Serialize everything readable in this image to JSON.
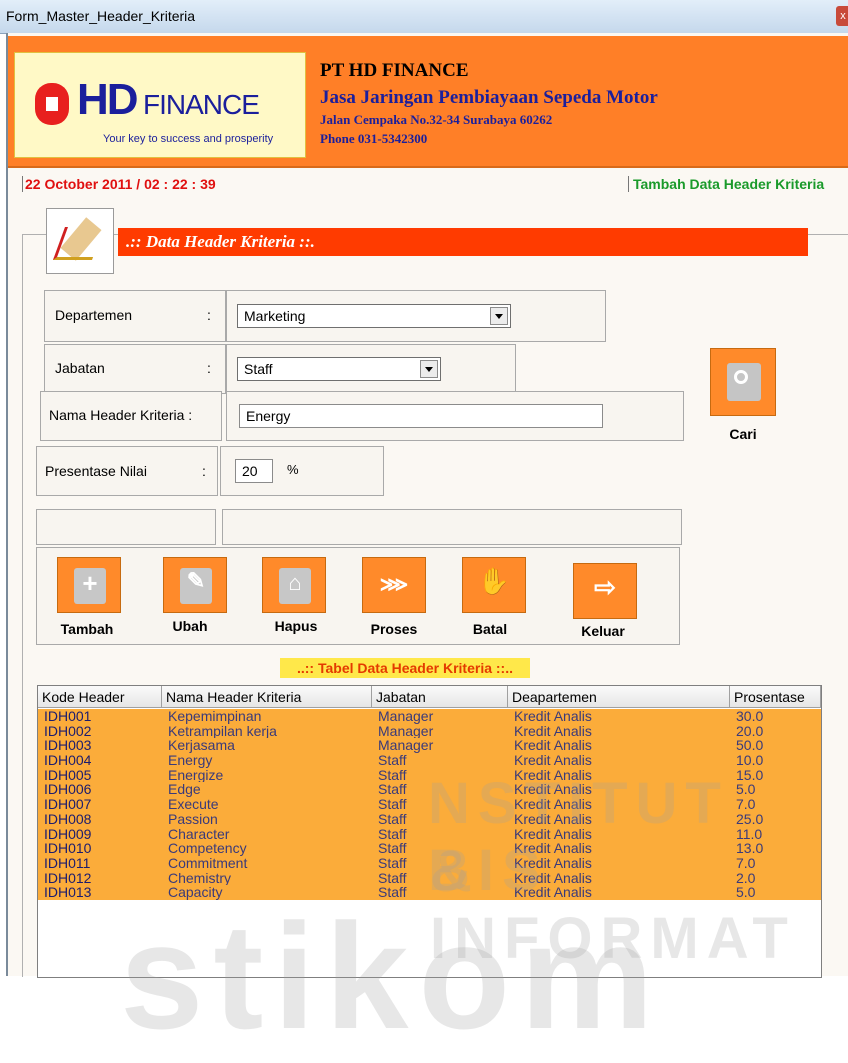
{
  "window": {
    "title": "Form_Master_Header_Kriteria",
    "close_glyph": "x"
  },
  "company": {
    "logo_brand": "HD",
    "logo_word": "FINANCE",
    "logo_tagline": "Your key to success and prosperity",
    "name": "PT HD FINANCE",
    "tagline": "Jasa Jaringan Pembiayaan Sepeda Motor",
    "address": "Jalan Cempaka No.32-34 Surabaya 60262",
    "phone": "Phone 031-5342300"
  },
  "status": {
    "datetime": "22 October 2011 / 02 : 22 : 39",
    "mode": "Tambah Data Header Kriteria"
  },
  "panel": {
    "title": ".:: Data Header Kriteria ::."
  },
  "form": {
    "departemen": {
      "label": "Departemen",
      "colon": ":",
      "value": "Marketing"
    },
    "jabatan": {
      "label": "Jabatan",
      "colon": ":",
      "value": "Staff"
    },
    "nama": {
      "label": "Nama Header Kriteria :",
      "value": "Energy"
    },
    "presentase": {
      "label": "Presentase Nilai",
      "colon": ":",
      "value": "20",
      "unit": "%"
    },
    "cari_label": "Cari"
  },
  "buttons": [
    {
      "label": "Tambah",
      "icon": "plus-icon"
    },
    {
      "label": "Ubah",
      "icon": "pencil-icon"
    },
    {
      "label": "Hapus",
      "icon": "basket-icon"
    },
    {
      "label": "Proses",
      "icon": "process-icon"
    },
    {
      "label": "Batal",
      "icon": "hand-icon"
    },
    {
      "label": "Keluar",
      "icon": "exit-icon"
    }
  ],
  "table": {
    "caption": "..:: Tabel Data Header Kriteria ::..",
    "headers": [
      "Kode Header",
      "Nama Header Kriteria",
      "Jabatan",
      "Deapartemen",
      "Prosentase"
    ],
    "rows": [
      [
        "IDH001",
        "Kepemimpinan",
        "Manager",
        "Kredit Analis",
        "30.0"
      ],
      [
        "IDH002",
        "Ketrampilan kerja",
        "Manager",
        "Kredit Analis",
        "20.0"
      ],
      [
        "IDH003",
        "Kerjasama",
        "Manager",
        "Kredit Analis",
        "50.0"
      ],
      [
        "IDH004",
        "Energy",
        "Staff",
        "Kredit Analis",
        "10.0"
      ],
      [
        "IDH005",
        "Energize",
        "Staff",
        "Kredit Analis",
        "15.0"
      ],
      [
        "IDH006",
        "Edge",
        "Staff",
        "Kredit Analis",
        "5.0"
      ],
      [
        "IDH007",
        "Execute",
        "Staff",
        "Kredit Analis",
        "7.0"
      ],
      [
        "IDH008",
        "Passion",
        "Staff",
        "Kredit Analis",
        "25.0"
      ],
      [
        "IDH009",
        "Character",
        "Staff",
        "Kredit Analis",
        "11.0"
      ],
      [
        "IDH010",
        "Competency",
        "Staff",
        "Kredit Analis",
        "13.0"
      ],
      [
        "IDH011",
        "Commitment",
        "Staff",
        "Kredit Analis",
        "7.0"
      ],
      [
        "IDH012",
        "Chemistry",
        "Staff",
        "Kredit Analis",
        "2.0"
      ],
      [
        "IDH013",
        "Capacity",
        "Staff",
        "Kredit Analis",
        "5.0"
      ]
    ]
  },
  "watermark": {
    "line1": "NSTITUT BIS",
    "line2": "& INFORMAT",
    "line3": "stikom"
  }
}
